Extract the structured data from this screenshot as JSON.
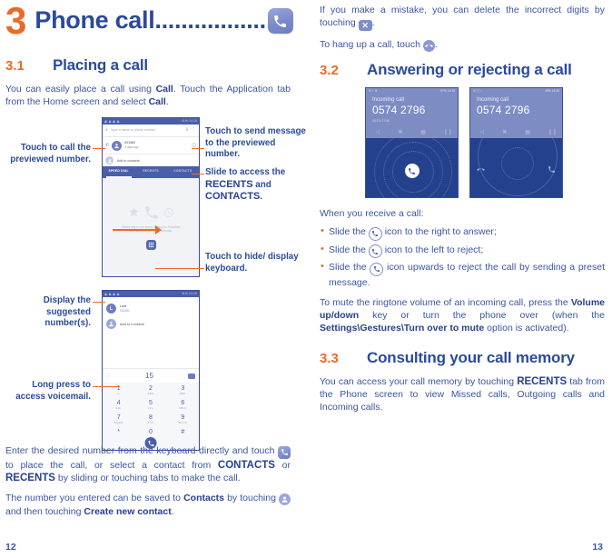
{
  "chapter": {
    "number": "3",
    "title": "Phone call.................",
    "icon": "phone-icon"
  },
  "left_column": {
    "sections": [
      {
        "number": "3.1",
        "title": "Placing a call",
        "intro_1": "You can easily place a call using ",
        "intro_b1": "Call",
        "intro_2": ". Touch the Application tab from the Home screen and select ",
        "intro_b2": "Call",
        "intro_3": "."
      }
    ],
    "callouts": {
      "call_previewed": "Touch to call the previewed number.",
      "send_message": "Touch to send message to the previewed number.",
      "slide_access_1": "Slide to access the ",
      "slide_access_b1": "RECENTS",
      "slide_access_2": " and ",
      "slide_access_b2": "CONTACTS",
      "slide_access_3": ".",
      "hide_keyboard": "Touch to hide/ display keyboard.",
      "display_suggested": "Display the suggested number(s).",
      "long_press_voicemail": "Long press to access voicemail."
    },
    "paragraphs": {
      "p1_a": "Enter the desired number from the keyboard directly and touch ",
      "p1_icon": "call-icon",
      "p1_b": " to place the call, or select a contact from ",
      "p1_bold1": "CONTACTS",
      "p1_c": " or ",
      "p1_bold2": "RECENTS",
      "p1_d": " by sliding or touching tabs to make the call.",
      "p2_a": "The number you entered can be saved to ",
      "p2_bold1": "Contacts",
      "p2_b": " by touching ",
      "p2_icon": "add-contact-icon",
      "p2_c": " and then touching ",
      "p2_bold2": "Create new contact",
      "p2_d": "."
    },
    "page_number": "12"
  },
  "phone_shot_1": {
    "status_left": "",
    "status_right": "41%  14:15",
    "search_placeholder": "Type a name or phone number",
    "mic_icon": "mic-icon",
    "overflow_icon": "more-vert-icon",
    "preview_number": "001582",
    "preview_meta": "3 days ago",
    "message_icon": "message-icon",
    "call_small_icon": "phone-small-icon",
    "add_to_contacts": "Add to contacts",
    "tabs": [
      "SPEED DIAL",
      "RECENTS",
      "CONTACTS"
    ],
    "active_tab": "SPEED DIAL",
    "empty_caption": "Speed dial is one touch dialling for Favorites and numbers you call frequently.",
    "keypad_fab_icon": "dialpad-icon"
  },
  "phone_shot_2": {
    "status_right": "41%  14:15",
    "suggestion_name": "Lara",
    "suggestion_number": "001582",
    "add_to_contacts": "Add to Contacts",
    "dialed_value": "15",
    "backspace_icon": "backspace-icon",
    "overflow_icon": "more-vert-icon",
    "keys": [
      {
        "digit": "1",
        "letters": "∞"
      },
      {
        "digit": "2",
        "letters": "ABC"
      },
      {
        "digit": "3",
        "letters": "DEF"
      },
      {
        "digit": "4",
        "letters": "GHI"
      },
      {
        "digit": "5",
        "letters": "JKL"
      },
      {
        "digit": "6",
        "letters": "MNO"
      },
      {
        "digit": "7",
        "letters": "PQRS"
      },
      {
        "digit": "8",
        "letters": "TUV"
      },
      {
        "digit": "9",
        "letters": "WXYZ"
      },
      {
        "digit": "*",
        "letters": ""
      },
      {
        "digit": "0",
        "letters": "+"
      },
      {
        "digit": "#",
        "letters": ""
      }
    ],
    "call_fab_icon": "phone-icon"
  },
  "right_column": {
    "intro": {
      "p1_a": "If you make a mistake, you can delete the incorrect digits by touching ",
      "p1_icon": "backspace-icon",
      "p1_b": ".",
      "p2_a": "To hang up a call, touch ",
      "p2_icon": "end-call-icon",
      "p2_b": "."
    },
    "sections": [
      {
        "number": "3.2",
        "title": "Answering or rejecting a call"
      },
      {
        "number": "3.3",
        "title": "Consulting your call memory"
      }
    ],
    "receive_label": "When you receive a call:",
    "bullets": [
      {
        "a": "Slide the ",
        "icon": "phone-circle-icon",
        "b": " icon to the right to answer;"
      },
      {
        "a": "Slide the ",
        "icon": "phone-circle-icon",
        "b": " icon to the left to reject;"
      },
      {
        "a": "Slide the ",
        "icon": "phone-circle-icon",
        "b": " icon upwards to reject the call by sending a preset message."
      }
    ],
    "mute_p": {
      "a": "To mute the ringtone volume of an incoming call, press the ",
      "b1": "Volume up/down",
      "b": " key or turn the phone over (when the ",
      "b2": "Settings\\Gestures\\Turn over to mute",
      "c": " option is activated)."
    },
    "memory_p": {
      "a": "You can access your call memory by touching ",
      "b1": "RECENTS",
      "b": " tab from the Phone screen to view Missed calls, Outgoing calls and Incoming calls."
    },
    "page_number": "13"
  },
  "call_screen_1": {
    "status_right": "97%  14:19",
    "title": "Incoming call",
    "number": "0574 2796",
    "sub_number": "0574 2796",
    "answer_icon": "phone-icon"
  },
  "call_screen_2": {
    "status_right": "48%  14:35",
    "title": "Incoming call",
    "number": "0574 2796",
    "message_icon": "message-icon",
    "reject_icon": "end-call-icon",
    "answer_icon": "phone-icon"
  },
  "colors": {
    "accent_orange": "#ec6a27",
    "heading_blue": "#2b4a9b",
    "body_blue": "#3a55a4",
    "screen_dark_blue": "#24418e",
    "screen_light_blue": "#7e8cc4"
  }
}
